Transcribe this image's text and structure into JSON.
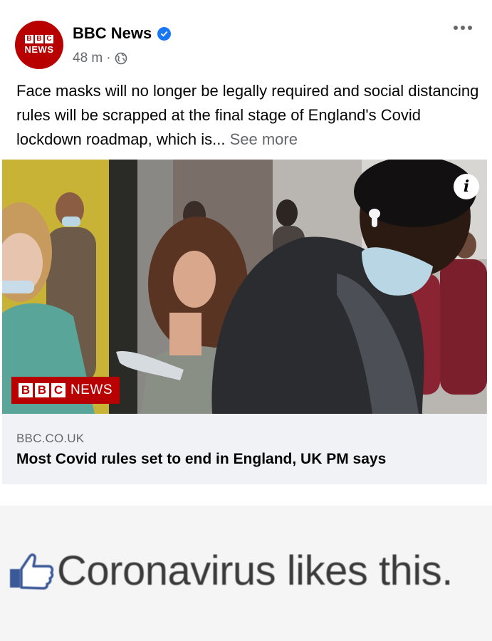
{
  "post": {
    "avatar": {
      "bbc_letters": [
        "B",
        "B",
        "C"
      ],
      "news": "NEWS"
    },
    "page_name": "BBC News",
    "verified": true,
    "time": "48 m",
    "separator": "·",
    "audience_icon": "globe-icon",
    "more_icon": "more-options-icon",
    "text": "Face masks will no longer be legally required and social distancing rules will be scrapped at the final stage of England's Covid lockdown roadmap, which is...",
    "see_more": "See more"
  },
  "link_preview": {
    "image_overlay": {
      "bbc_letters": [
        "B",
        "B",
        "C"
      ],
      "news": "NEWS"
    },
    "info_icon": "info-icon",
    "domain": "BBC.CO.UK",
    "title": "Most Covid rules set to end in England, UK PM says"
  },
  "caption": {
    "icon": "thumbs-up-like-icon",
    "text": "Coronavirus likes this."
  },
  "colors": {
    "bbc_red": "#b80000",
    "verified_blue": "#1877f2",
    "secondary_text": "#65676b",
    "card_background": "#f0f2f5",
    "like_blue": "#3b5998"
  }
}
